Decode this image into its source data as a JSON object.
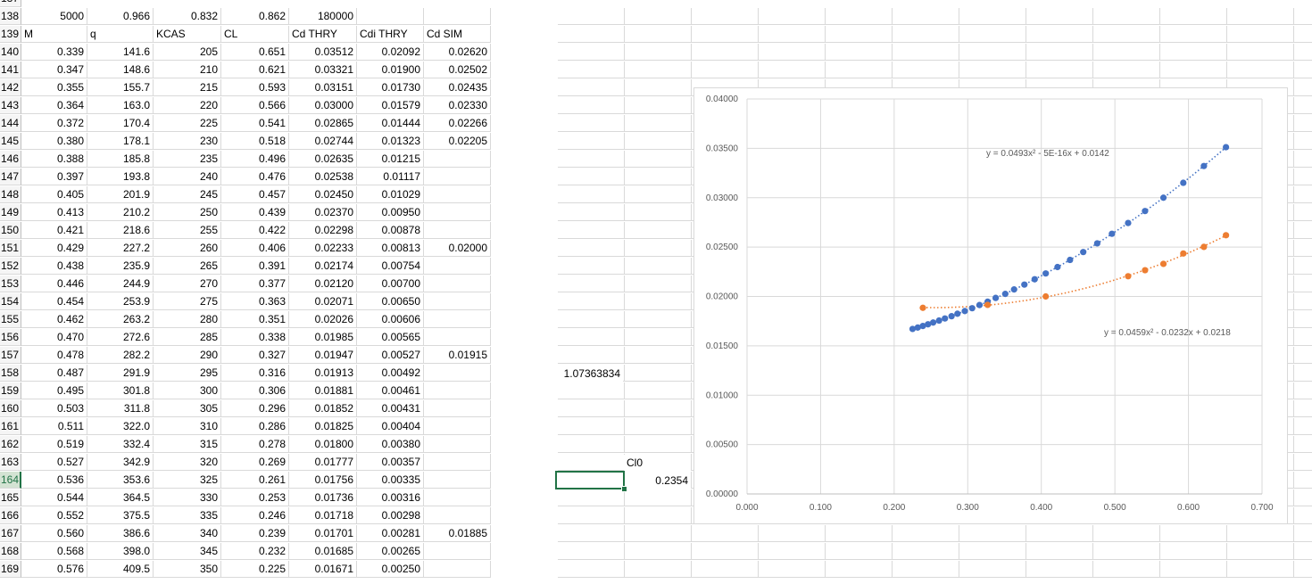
{
  "sheet": {
    "top_row_number": "137",
    "rows": [
      {
        "n": "138",
        "cells": [
          "5000",
          "0.966",
          "0.832",
          "0.862",
          "180000",
          "",
          "",
          ""
        ]
      },
      {
        "n": "139",
        "cells": [
          "M",
          "q",
          "KCAS",
          "CL",
          "Cd THRY",
          "Cdi THRY",
          "Cd SIM",
          ""
        ]
      },
      {
        "n": "140",
        "cells": [
          "0.339",
          "141.6",
          "205",
          "0.651",
          "0.03512",
          "0.02092",
          "0.02620"
        ]
      },
      {
        "n": "141",
        "cells": [
          "0.347",
          "148.6",
          "210",
          "0.621",
          "0.03321",
          "0.01900",
          "0.02502"
        ]
      },
      {
        "n": "142",
        "cells": [
          "0.355",
          "155.7",
          "215",
          "0.593",
          "0.03151",
          "0.01730",
          "0.02435"
        ]
      },
      {
        "n": "143",
        "cells": [
          "0.364",
          "163.0",
          "220",
          "0.566",
          "0.03000",
          "0.01579",
          "0.02330"
        ]
      },
      {
        "n": "144",
        "cells": [
          "0.372",
          "170.4",
          "225",
          "0.541",
          "0.02865",
          "0.01444",
          "0.02266"
        ]
      },
      {
        "n": "145",
        "cells": [
          "0.380",
          "178.1",
          "230",
          "0.518",
          "0.02744",
          "0.01323",
          "0.02205"
        ]
      },
      {
        "n": "146",
        "cells": [
          "0.388",
          "185.8",
          "235",
          "0.496",
          "0.02635",
          "0.01215",
          ""
        ]
      },
      {
        "n": "147",
        "cells": [
          "0.397",
          "193.8",
          "240",
          "0.476",
          "0.02538",
          "0.01117",
          ""
        ]
      },
      {
        "n": "148",
        "cells": [
          "0.405",
          "201.9",
          "245",
          "0.457",
          "0.02450",
          "0.01029",
          ""
        ]
      },
      {
        "n": "149",
        "cells": [
          "0.413",
          "210.2",
          "250",
          "0.439",
          "0.02370",
          "0.00950",
          ""
        ]
      },
      {
        "n": "150",
        "cells": [
          "0.421",
          "218.6",
          "255",
          "0.422",
          "0.02298",
          "0.00878",
          ""
        ]
      },
      {
        "n": "151",
        "cells": [
          "0.429",
          "227.2",
          "260",
          "0.406",
          "0.02233",
          "0.00813",
          "0.02000"
        ]
      },
      {
        "n": "152",
        "cells": [
          "0.438",
          "235.9",
          "265",
          "0.391",
          "0.02174",
          "0.00754",
          ""
        ]
      },
      {
        "n": "153",
        "cells": [
          "0.446",
          "244.9",
          "270",
          "0.377",
          "0.02120",
          "0.00700",
          ""
        ]
      },
      {
        "n": "154",
        "cells": [
          "0.454",
          "253.9",
          "275",
          "0.363",
          "0.02071",
          "0.00650",
          ""
        ]
      },
      {
        "n": "155",
        "cells": [
          "0.462",
          "263.2",
          "280",
          "0.351",
          "0.02026",
          "0.00606",
          ""
        ]
      },
      {
        "n": "156",
        "cells": [
          "0.470",
          "272.6",
          "285",
          "0.338",
          "0.01985",
          "0.00565",
          ""
        ]
      },
      {
        "n": "157",
        "cells": [
          "0.478",
          "282.2",
          "290",
          "0.327",
          "0.01947",
          "0.00527",
          "0.01915"
        ]
      },
      {
        "n": "158",
        "cells": [
          "0.487",
          "291.9",
          "295",
          "0.316",
          "0.01913",
          "0.00492",
          ""
        ]
      },
      {
        "n": "159",
        "cells": [
          "0.495",
          "301.8",
          "300",
          "0.306",
          "0.01881",
          "0.00461",
          ""
        ]
      },
      {
        "n": "160",
        "cells": [
          "0.503",
          "311.8",
          "305",
          "0.296",
          "0.01852",
          "0.00431",
          ""
        ]
      },
      {
        "n": "161",
        "cells": [
          "0.511",
          "322.0",
          "310",
          "0.286",
          "0.01825",
          "0.00404",
          ""
        ]
      },
      {
        "n": "162",
        "cells": [
          "0.519",
          "332.4",
          "315",
          "0.278",
          "0.01800",
          "0.00380",
          ""
        ]
      },
      {
        "n": "163",
        "cells": [
          "0.527",
          "342.9",
          "320",
          "0.269",
          "0.01777",
          "0.00357",
          ""
        ]
      },
      {
        "n": "164",
        "cells": [
          "0.536",
          "353.6",
          "325",
          "0.261",
          "0.01756",
          "0.00335",
          ""
        ]
      },
      {
        "n": "165",
        "cells": [
          "0.544",
          "364.5",
          "330",
          "0.253",
          "0.01736",
          "0.00316",
          ""
        ]
      },
      {
        "n": "166",
        "cells": [
          "0.552",
          "375.5",
          "335",
          "0.246",
          "0.01718",
          "0.00298",
          ""
        ]
      },
      {
        "n": "167",
        "cells": [
          "0.560",
          "386.6",
          "340",
          "0.239",
          "0.01701",
          "0.00281",
          "0.01885"
        ]
      },
      {
        "n": "168",
        "cells": [
          "0.568",
          "398.0",
          "345",
          "0.232",
          "0.01685",
          "0.00265",
          ""
        ]
      },
      {
        "n": "169",
        "cells": [
          "0.576",
          "409.5",
          "350",
          "0.225",
          "0.01671",
          "0.00250",
          ""
        ]
      }
    ],
    "selected_row": "164",
    "extra_value_158": "1.07363834",
    "cl0_label": "Cl0",
    "cl0_value": "0.2354"
  },
  "colors": {
    "series1": "#4472c4",
    "series2": "#ed7d31",
    "grid": "#d9d9d9",
    "selection": "#217346"
  },
  "chart_data": {
    "type": "scatter",
    "xlim": [
      0,
      0.7
    ],
    "ylim": [
      0,
      0.04
    ],
    "x_ticks": [
      "0.000",
      "0.100",
      "0.200",
      "0.300",
      "0.400",
      "0.500",
      "0.600",
      "0.700"
    ],
    "y_ticks": [
      "0.00000",
      "0.00500",
      "0.01000",
      "0.01500",
      "0.02000",
      "0.02500",
      "0.03000",
      "0.03500",
      "0.04000"
    ],
    "grid": true,
    "series": [
      {
        "color": "#4472c4",
        "trendline": "y = 0.0493x² - 5E-16x + 0.0142",
        "x": [
          0.651,
          0.621,
          0.593,
          0.566,
          0.541,
          0.518,
          0.496,
          0.476,
          0.457,
          0.439,
          0.422,
          0.406,
          0.391,
          0.377,
          0.363,
          0.351,
          0.338,
          0.327,
          0.316,
          0.306,
          0.296,
          0.286,
          0.278,
          0.269,
          0.261,
          0.253,
          0.246,
          0.239,
          0.232,
          0.225
        ],
        "y": [
          0.03512,
          0.03321,
          0.03151,
          0.03,
          0.02865,
          0.02744,
          0.02635,
          0.02538,
          0.0245,
          0.0237,
          0.02298,
          0.02233,
          0.02174,
          0.0212,
          0.02071,
          0.02026,
          0.01985,
          0.01947,
          0.01913,
          0.01881,
          0.01852,
          0.01825,
          0.018,
          0.01777,
          0.01756,
          0.01736,
          0.01718,
          0.01701,
          0.01685,
          0.01671
        ]
      },
      {
        "color": "#ed7d31",
        "trendline": "y = 0.0459x² - 0.0232x + 0.0218",
        "x": [
          0.651,
          0.621,
          0.593,
          0.566,
          0.541,
          0.518,
          0.406,
          0.327,
          0.239
        ],
        "y": [
          0.0262,
          0.02502,
          0.02435,
          0.0233,
          0.02266,
          0.02205,
          0.02,
          0.01915,
          0.01885
        ]
      }
    ]
  }
}
